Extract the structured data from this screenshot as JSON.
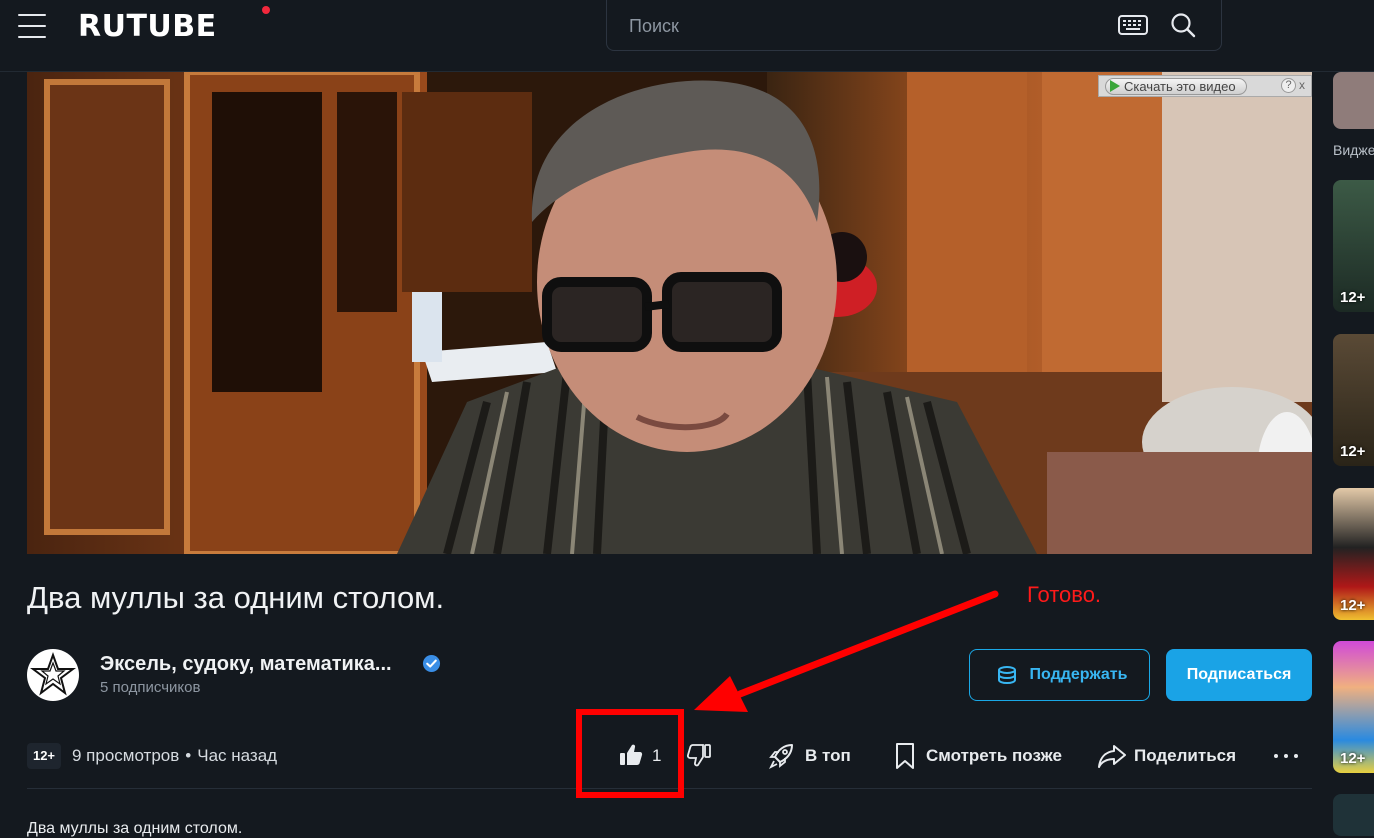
{
  "header": {
    "logo": "RUTUBE",
    "search_placeholder": "Поиск",
    "icons": [
      "menu-icon",
      "keyboard-icon",
      "search-icon"
    ]
  },
  "player": {
    "download_bar_label": "Скачать это видео",
    "download_help": "?",
    "download_close": "x"
  },
  "video": {
    "title": "Два муллы за одним столом.",
    "age_rating": "12+",
    "views": "9 просмотров",
    "meta_separator": "•",
    "published": "Час назад",
    "description": "Два муллы за одним столом."
  },
  "channel": {
    "name": "Эксель, судоку, математика...",
    "subscribers": "5 подписчиков",
    "verified": true
  },
  "buttons": {
    "support": "Поддержать",
    "subscribe": "Подписаться"
  },
  "actions": {
    "like_count": "1",
    "to_top": "В топ",
    "watch_later": "Смотреть позже",
    "share": "Поделиться"
  },
  "annotation": {
    "text": "Готово.",
    "color": "#ff0000"
  },
  "sidebar": {
    "label": "Видже",
    "thumbs": [
      {
        "age": ""
      },
      {
        "age": "12+"
      },
      {
        "age": "12+"
      },
      {
        "age": "12+"
      },
      {
        "age": "12+"
      },
      {
        "age": ""
      }
    ]
  },
  "colors": {
    "background": "#14191f",
    "accent": "#1aa3e6",
    "logo_dot": "#f2283c"
  }
}
